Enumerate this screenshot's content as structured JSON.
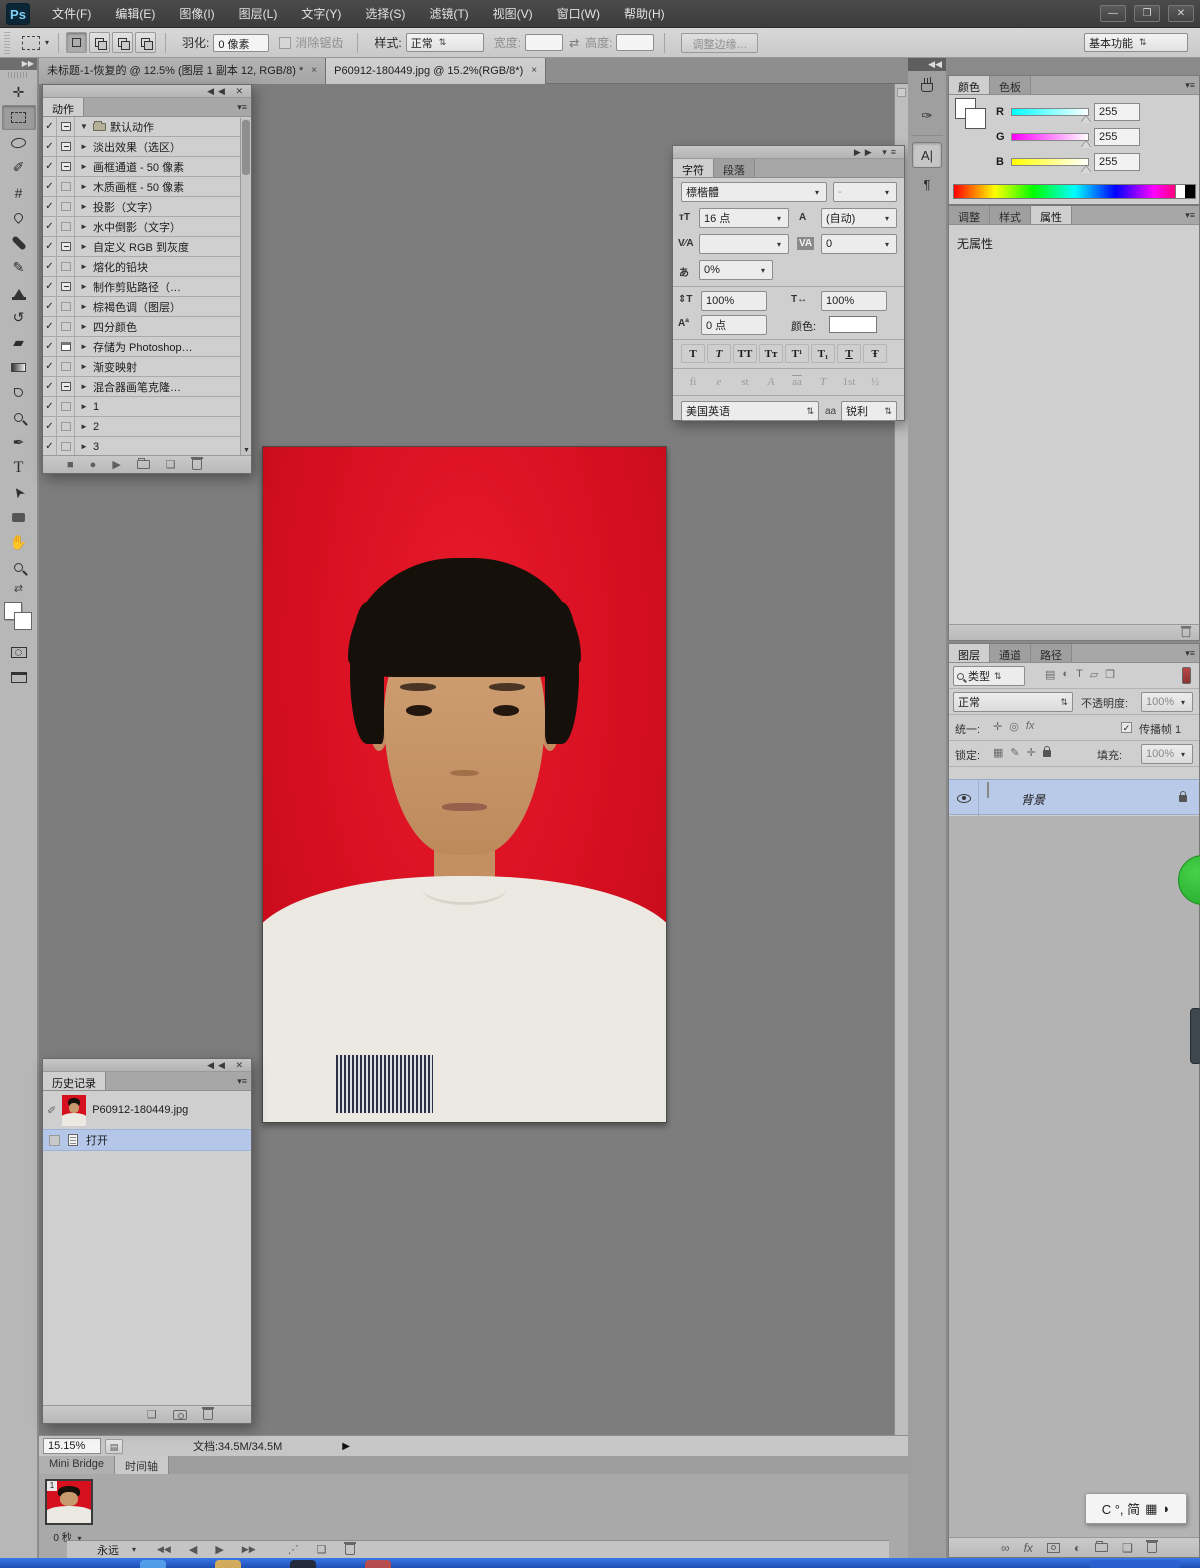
{
  "icons": {
    "check": "✓",
    "expand_right": "►",
    "expand_down": "▼",
    "panel_menu": "▾≡",
    "collapse_left": "◀◀",
    "collapse_right": "▶▶",
    "close": "✕",
    "minimize": "—",
    "restore": "❐",
    "dd": "▾",
    "updown": "⇅",
    "swap": "⇄",
    "stop": "■",
    "record": "●",
    "play": "▶",
    "first": "◀◀",
    "prev": "◀",
    "next": "▶",
    "last": "▶▶",
    "tween": "⋰",
    "dup": "❏",
    "link": "∞",
    "fx": "fx",
    "adjust": "◐",
    "newdoc": "❏",
    "move": "✛",
    "quickselect": "✐",
    "crop": "#",
    "pen": "✒",
    "type": "T",
    "pathselect": "➤",
    "hand": "✋",
    "historybrush": "↺",
    "eraser": "▰",
    "brush": "✎",
    "snapshot_brush": "✐",
    "brush_preset": "✑",
    "char_a": "A|",
    "paragraph": "¶",
    "keyboard": "▦",
    "moon": "◗",
    "statarrow": "▶",
    "size_icon": "тT",
    "leading_icon": "A",
    "kern_icon": "V⁄A",
    "track_icon": "VA",
    "tsume_icon": "あ",
    "vscale_icon": "⇕T",
    "hscale_icon": "T↔",
    "baseline_icon": "Aª",
    "img_filter": "▤",
    "vec_filter": "▱",
    "smart_filter": "❐",
    "unify1": "✛",
    "unify2": "◎",
    "unify3": "fx",
    "lock_checker": "▦",
    "lock_brush": "✎",
    "lock_move": "✛"
  },
  "titlebar": {
    "logo": "Ps",
    "menus": [
      "文件(F)",
      "编辑(E)",
      "图像(I)",
      "图层(L)",
      "文字(Y)",
      "选择(S)",
      "滤镜(T)",
      "视图(V)",
      "窗口(W)",
      "帮助(H)"
    ]
  },
  "options_bar": {
    "feather_label": "羽化:",
    "feather_value": "0 像素",
    "antialias_label": "消除锯齿",
    "style_label": "样式:",
    "style_value": "正常",
    "width_label": "宽度:",
    "width_value": "",
    "height_label": "高度:",
    "height_value": "",
    "refine_edge_label": "调整边缘…",
    "workspace": "基本功能"
  },
  "doc_tabs": [
    {
      "title": "未标题-1-恢复的 @ 12.5% (图层 1 副本 12, RGB/8) *",
      "close": "×"
    },
    {
      "title": "P60912-180449.jpg @ 15.2%(RGB/8*)",
      "close": "×"
    }
  ],
  "photo": {
    "background": "#d60f20",
    "skin": "#c89a6e",
    "hair": "#16100a",
    "shirt": "#ece9e3",
    "stripe_colors": [
      "#c23a52",
      "#ded32a",
      "#3c9a50",
      "#3fa6d6",
      "#2c3147"
    ]
  },
  "actions_panel": {
    "title": "动作",
    "items": [
      {
        "label": "默认动作",
        "modal": "on",
        "folder": true
      },
      {
        "label": "淡出效果（选区）",
        "modal": "on"
      },
      {
        "label": "画框通道 - 50 像素",
        "modal": "on"
      },
      {
        "label": "木质画框 - 50 像素",
        "modal": "off"
      },
      {
        "label": "投影（文字）",
        "modal": "off"
      },
      {
        "label": "水中倒影（文字）",
        "modal": "off"
      },
      {
        "label": "自定义 RGB 到灰度",
        "modal": "on"
      },
      {
        "label": "熔化的铅块",
        "modal": "off"
      },
      {
        "label": "制作剪贴路径（…",
        "modal": "on"
      },
      {
        "label": "棕褐色调（图层）",
        "modal": "off"
      },
      {
        "label": "四分颜色",
        "modal": "off"
      },
      {
        "label": "存储为 Photoshop…",
        "modal": "dialog"
      },
      {
        "label": "渐变映射",
        "modal": "off"
      },
      {
        "label": "混合器画笔克隆…",
        "modal": "on"
      },
      {
        "label": "1",
        "modal": "off"
      },
      {
        "label": "2",
        "modal": "off"
      },
      {
        "label": "3",
        "modal": "off"
      }
    ]
  },
  "character_panel": {
    "tab_character": "字符",
    "tab_paragraph": "段落",
    "font_family": "標楷體",
    "font_style": "-",
    "size_value": "16 点",
    "leading_value": "(自动)",
    "kerning_value": "",
    "tracking_value": "0",
    "tsume_value": "0%",
    "vscale_value": "100%",
    "hscale_value": "100%",
    "baseline_value": "0 点",
    "color_label": "颜色:",
    "style_buttons": [
      "T",
      "T",
      "TT",
      "Tᴛ",
      "T¹",
      "T₁",
      "T",
      "Ŧ"
    ],
    "opentype_buttons": [
      "fi",
      "e",
      "st",
      "A",
      "aa",
      "T",
      "1st",
      "½"
    ],
    "language": "美国英语",
    "aa_label": "aa",
    "antialias": "锐利"
  },
  "history_panel": {
    "title": "历史记录",
    "snapshot_name": "P60912-180449.jpg",
    "state_name": "打开"
  },
  "color_panel": {
    "tab_color": "颜色",
    "tab_swatches": "色板",
    "channels": [
      {
        "label": "R",
        "value": "255"
      },
      {
        "label": "G",
        "value": "255"
      },
      {
        "label": "B",
        "value": "255"
      }
    ]
  },
  "props_panel": {
    "tab_adjust": "调整",
    "tab_styles": "样式",
    "tab_props": "属性",
    "content": "无属性"
  },
  "layers_panel": {
    "tab_layers": "图层",
    "tab_channels": "通道",
    "tab_paths": "路径",
    "filter_label": "类型",
    "blend_mode": "正常",
    "opacity_label": "不透明度:",
    "opacity_value": "100%",
    "unify_label": "统一:",
    "propagate_label": "传播帧 1",
    "lock_label": "锁定:",
    "fill_label": "填充:",
    "fill_value": "100%",
    "layer_name": "背景"
  },
  "statusbar": {
    "zoom": "15.15%",
    "doc_info": "文档:34.5M/34.5M"
  },
  "bottom_tabs": {
    "mini_bridge": "Mini Bridge",
    "timeline": "时间轴"
  },
  "timeline": {
    "frame_number": "1",
    "frame_delay": "0 秒",
    "loop": "永远"
  },
  "ime": {
    "text": "C °, 简"
  }
}
